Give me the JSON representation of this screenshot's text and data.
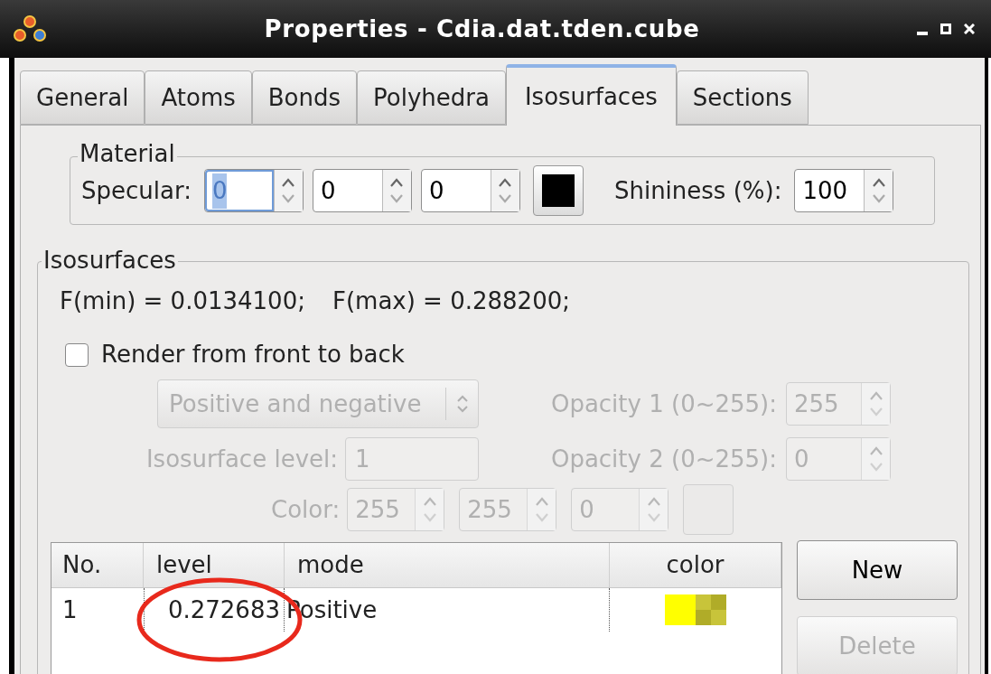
{
  "window": {
    "title": "Properties - Cdia.dat.tden.cube"
  },
  "tabs": [
    {
      "label": "General",
      "selected": false
    },
    {
      "label": "Atoms",
      "selected": false
    },
    {
      "label": "Bonds",
      "selected": false
    },
    {
      "label": "Polyhedra",
      "selected": false
    },
    {
      "label": "Isosurfaces",
      "selected": true
    },
    {
      "label": "Sections",
      "selected": false
    }
  ],
  "material": {
    "title": "Material",
    "specular_label": "Specular:",
    "specular": [
      "0",
      "0",
      "0"
    ],
    "shininess_label": "Shininess (%):",
    "shininess": "100"
  },
  "isosurfaces": {
    "title": "Isosurfaces",
    "range": [
      "F(min) = 0.0134100;",
      "F(max) = 0.288200;"
    ],
    "render_front_to_back": {
      "label": "Render from front to back",
      "checked": false
    },
    "settings": {
      "disabled": true,
      "mode": "Positive and negative",
      "isosurface_level_label": "Isosurface level:",
      "isosurface_level": "1",
      "opacity1_label": "Opacity 1 (0~255):",
      "opacity1": "255",
      "opacity2_label": "Opacity 2 (0~255):",
      "opacity2": "0",
      "color_label": "Color:",
      "rgb": [
        "255",
        "255",
        "0"
      ]
    },
    "table": {
      "columns": [
        "No.",
        "level",
        "mode",
        "color"
      ],
      "rows": [
        {
          "no": "1",
          "level": "0.272683",
          "mode": "Positive",
          "color": "#ffff00"
        }
      ]
    },
    "buttons": [
      {
        "label": "New",
        "disabled": false
      },
      {
        "label": "Delete",
        "disabled": true
      }
    ]
  }
}
